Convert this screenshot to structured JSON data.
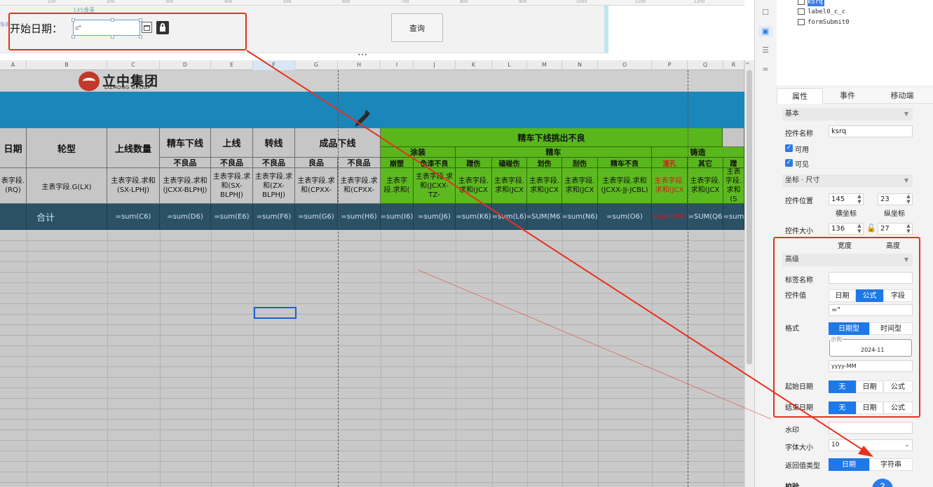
{
  "ruler": {
    "ticks": [
      "100",
      "200",
      "300",
      "400",
      "500",
      "600",
      "700",
      "800",
      "900",
      "1000",
      "1100",
      "1200"
    ],
    "width_caption": "145像素",
    "side_caption": "像素"
  },
  "param_bar": {
    "start_label": "开始日期：",
    "date_value": "=\"",
    "query_label": "查询"
  },
  "columns": [
    "A",
    "B",
    "C",
    "D",
    "E",
    "F",
    "G",
    "H",
    "I",
    "J",
    "K",
    "L",
    "M",
    "N",
    "O",
    "P",
    "Q",
    "R"
  ],
  "logo": {
    "cn": "立中集团",
    "en": "LIZHONG GROUP"
  },
  "table": {
    "h_date": "日期",
    "h_wheel": "轮型",
    "h_qty": "上线数量",
    "h_fine": "精车下线",
    "h_online": "上线",
    "h_transfer": "转线",
    "h_finished": "成品下线",
    "h_pick": "精车下线挑出不良",
    "h_bad1": "不良品",
    "h_bad2": "不良品",
    "h_bad3": "不良品",
    "h_good": "良品",
    "h_bad4": "不良品",
    "h_paint": "涂装",
    "h_finecar": "精车",
    "h_cast": "铸造",
    "h_spray": "崩塑",
    "h_color": "色漆不良",
    "h_rub": "蹭伤",
    "h_bump": "磕碰伤",
    "h_scratch": "划伤",
    "h_scrape": "刮伤",
    "h_finebad": "精车不良",
    "h_pore": "渣孔",
    "h_other": "其它",
    "h_rub2": "蹭",
    "f_rq": "表字段.(RQ)",
    "f_lx": "主表字段.G(LX)",
    "f_c": "主表字段.求和(SX-LPHJ)",
    "f_d": "主表字段.求和(JCXX-BLPHJ)",
    "f_e": "主表字段.求和(SX-BLPHJ)",
    "f_f": "主表字段.求和(ZX-BLPHJ)",
    "f_g": "主表字段.求和(CPXX-",
    "f_h": "主表字段.求和(CPXX-",
    "f_i": "主表字段.求和(",
    "f_j": "主表字段.求和(JCXX-TZ-",
    "f_k": "主表字段.求和(JCX",
    "f_l": "主表字段.求和(JCX",
    "f_m": "主表字段.求和(JCX",
    "f_n": "主表字段.求和(JCX",
    "f_o": "主表字段.求和(JCXX-JJ-JCBL)",
    "f_p": "主表字段.求和(JCX",
    "f_q": "主表字段.求和(JCX",
    "f_r": "主表字段.求和(S",
    "t_total": "合计",
    "t_c": "=sum(C6)",
    "t_d": "=sum(D6)",
    "t_e": "=sum(E6)",
    "t_f": "=sum(F6)",
    "t_g": "=sum(G6)",
    "t_h": "=sum(H6)",
    "t_i": "=sum(I6)",
    "t_j": "=sum(J6)",
    "t_k": "=sum(K6)",
    "t_l": "=sum(L6)",
    "t_m": "=SUM(M6)",
    "t_n": "=sum(N6)",
    "t_o": "=sum(O6)",
    "t_p": "=sum(P6)",
    "t_q": "=SUM(Q6",
    "t_r": "=sum"
  },
  "tree": {
    "items": [
      "ksrq",
      "label0_c_c",
      "formSubmit0"
    ]
  },
  "tabs": {
    "props": "属性",
    "events": "事件",
    "mobile": "移动端"
  },
  "panel": {
    "basic": "基本",
    "name_label": "控件名称",
    "name_value": "ksrq",
    "usable": "可用",
    "visible": "可见",
    "coord_section": "坐标 · 尺寸",
    "pos_label": "控件位置",
    "x_value": "145",
    "y_value": "23",
    "x_caption": "横坐标",
    "y_caption": "纵坐标",
    "size_label": "控件大小",
    "w_value": "136",
    "h_value": "27",
    "w_caption": "宽度",
    "h_caption": "高度",
    "advanced": "高级",
    "tag_label": "标签名称",
    "value_label": "控件值",
    "value_opt_date": "日期",
    "value_opt_formula": "公式",
    "value_opt_field": "字段",
    "value_text": "=\"",
    "format_label": "格式",
    "fmt_date": "日期型",
    "fmt_time": "时间型",
    "sample_legend": "示例",
    "sample_value": "2024-11",
    "format_value": "yyyy-MM",
    "start_label": "起始日期",
    "end_label": "结束日期",
    "opt_none": "无",
    "opt_date": "日期",
    "opt_formula": "公式",
    "watermark_label": "水印",
    "font_label": "字体大小",
    "font_value": "10",
    "return_label": "返回值类型",
    "ret_date": "日期",
    "ret_string": "字符串",
    "next_label": "校验"
  },
  "colors": {
    "accent": "#1e78e6",
    "annotation": "#e8301f",
    "header_green": "#59b71c",
    "total_navy": "#2b5167",
    "banner_blue": "#1a86b9"
  },
  "icons": [
    "calendar-icon",
    "unlock-icon",
    "pencil-icon",
    "select-tool-icon",
    "layer-icon",
    "link-icon",
    "help-icon"
  ]
}
